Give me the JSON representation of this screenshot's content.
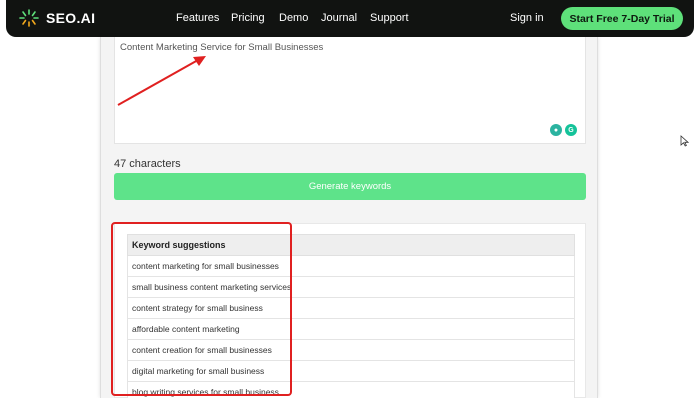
{
  "nav": {
    "logo_text": "SEO.AI",
    "links": [
      "Features",
      "Pricing",
      "Demo",
      "Journal",
      "Support"
    ],
    "signin": "Sign in",
    "cta": "Start Free 7-Day Trial"
  },
  "input": {
    "value": "Content Marketing Service for Small Businesses"
  },
  "char_count": "47 characters",
  "generate_button": "Generate keywords",
  "keywords": {
    "header": "Keyword suggestions",
    "items": [
      "content marketing for small businesses",
      "small business content marketing services",
      "content strategy for small business",
      "affordable content marketing",
      "content creation for small businesses",
      "digital marketing for small business",
      "blog writing services for small business"
    ]
  },
  "colors": {
    "nav_bg": "#111311",
    "accent_green": "#5ee07a",
    "annotation_red": "#e02020"
  }
}
